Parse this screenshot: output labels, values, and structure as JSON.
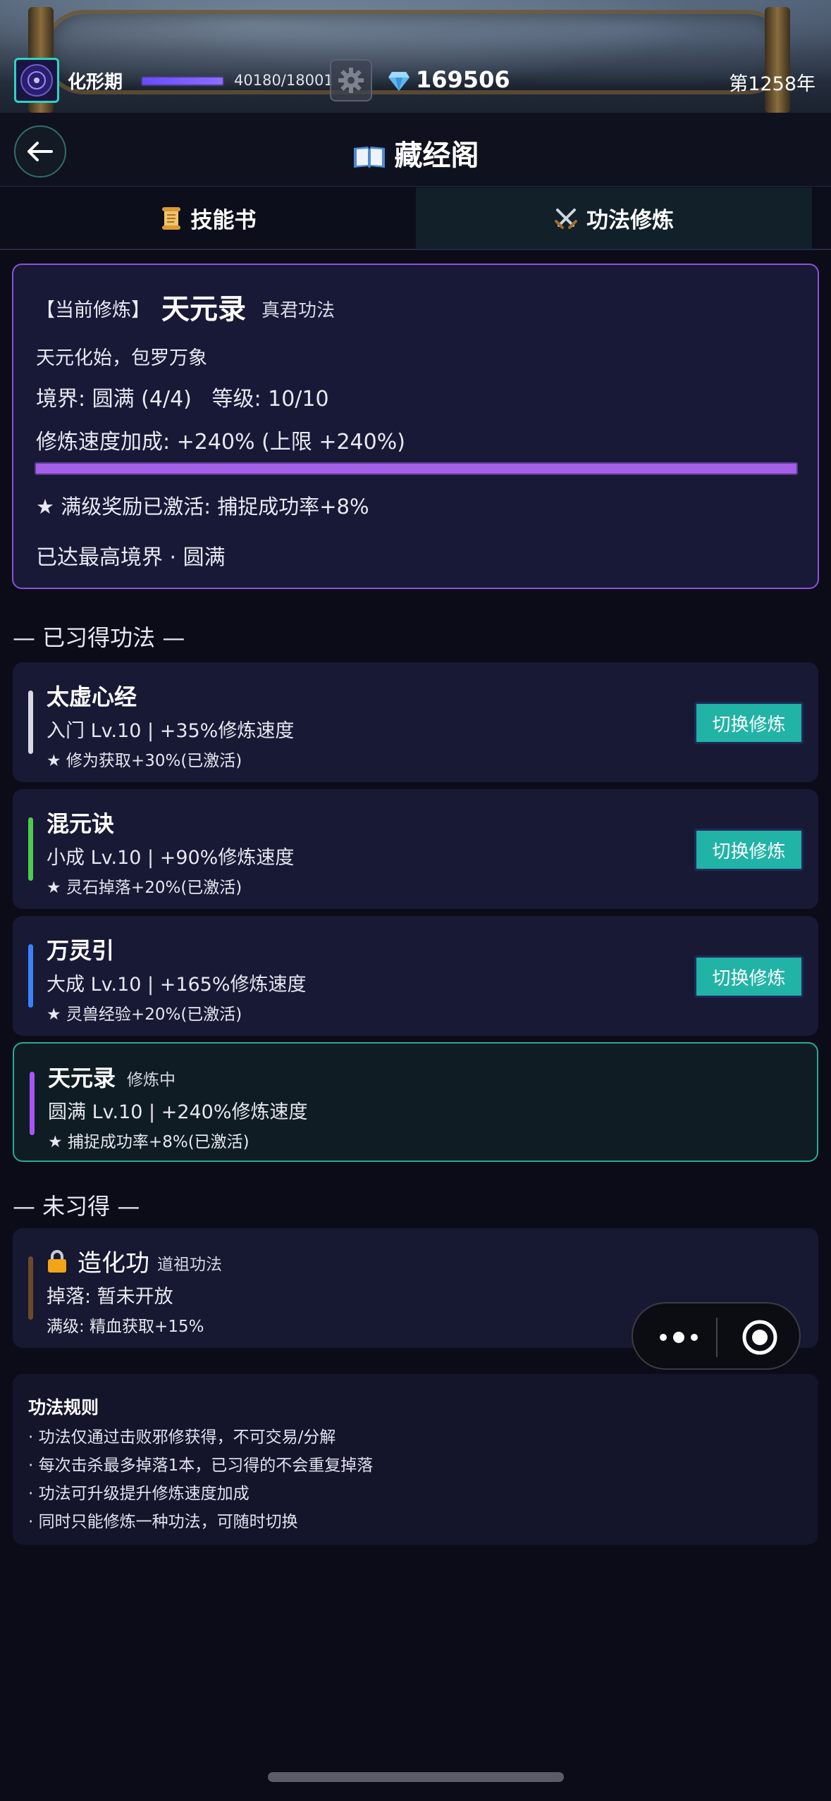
{
  "top_bar": {
    "realm": "化形期",
    "exp_text": "40180/18001",
    "exp_fill_fraction": 1.0,
    "gems": "169506",
    "year": "第1258年"
  },
  "header": {
    "title": "藏经阁"
  },
  "tabs": [
    {
      "label": "技能书",
      "icon": "scroll-icon",
      "active": false
    },
    {
      "label": "功法修炼",
      "icon": "crossed-swords-icon",
      "active": true
    }
  ],
  "current": {
    "label": "【当前修炼】",
    "name": "天元录",
    "grade": "真君功法",
    "desc": "天元化始，包罗万象",
    "realm_line": "境界: 圆满 (4/4)   等级: 10/10",
    "speed_line": "修炼速度加成: +240% (上限 +240%)",
    "progress_fraction": 1.0,
    "bonus_line": "★ 满级奖励已激活: 捕捉成功率+8%",
    "max_line": "已达最高境界 · 圆满"
  },
  "learned_title": "— 已习得功法 —",
  "learned": [
    {
      "name": "太虚心经",
      "status": "",
      "info": "入门 Lv.10 | +35%修炼速度",
      "bonus": "★ 修为获取+30%(已激活)",
      "accent": "#d9d9df",
      "button": "切换修炼"
    },
    {
      "name": "混元诀",
      "status": "",
      "info": "小成 Lv.10 | +90%修炼速度",
      "bonus": "★ 灵石掉落+20%(已激活)",
      "accent": "#4fc94f",
      "button": "切换修炼"
    },
    {
      "name": "万灵引",
      "status": "",
      "info": "大成 Lv.10 | +165%修炼速度",
      "bonus": "★ 灵兽经验+20%(已激活)",
      "accent": "#3b82f6",
      "button": "切换修炼"
    },
    {
      "name": "天元录",
      "status": "修炼中",
      "info": "圆满 Lv.10 | +240%修炼速度",
      "bonus": "★ 捕捉成功率+8%(已激活)",
      "accent": "#a855f7",
      "button": ""
    }
  ],
  "unlearned_title": "— 未习得 —",
  "unlearned": {
    "name": "造化功",
    "grade": "道祖功法",
    "drop": "掉落: 暂未开放",
    "max": "满级: 精血获取+15%",
    "accent": "#6b4a2a"
  },
  "rules": {
    "title": "功法规则",
    "lines": [
      "· 功法仅通过击败邪修获得，不可交易/分解",
      "· 每次击杀最多掉落1本，已习得的不会重复掉落",
      "· 功法可升级提升修炼速度加成",
      "· 同时只能修炼一种功法，可随时切换"
    ]
  },
  "colors": {
    "accent_teal": "#21b3a6",
    "accent_purple": "#a35fe8",
    "background": "#0b0c18"
  }
}
